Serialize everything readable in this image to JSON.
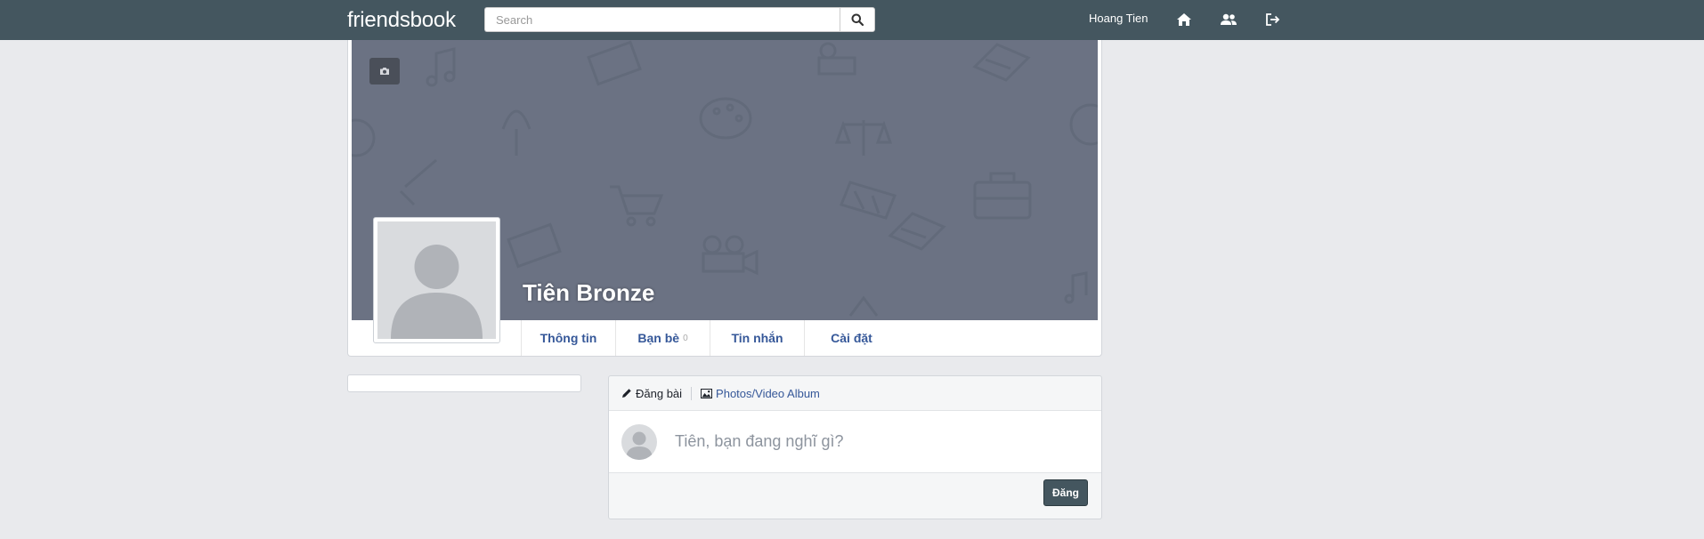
{
  "navbar": {
    "brand": "friendsbook",
    "search_placeholder": "Search",
    "user_name": "Hoang Tien",
    "icons": [
      "search-icon",
      "home-icon",
      "friends-icon",
      "logout-icon"
    ]
  },
  "profile": {
    "name": "Tiên Bronze",
    "tabs": [
      {
        "label": "Thông tin"
      },
      {
        "label": "Bạn bè",
        "count": "0"
      },
      {
        "label": "Tin nhắn"
      },
      {
        "label": "Cài đặt"
      }
    ]
  },
  "composer": {
    "post_tab_label": "Đăng bài",
    "photo_tab_label": "Photos/Video Album",
    "placeholder": "Tiên, bạn đang nghĩ gì?",
    "submit_label": "Đăng"
  },
  "colors": {
    "navbar_bg": "#44565f",
    "cover_bg": "#6b7283",
    "link": "#365899",
    "page_bg": "#e9eaed"
  }
}
